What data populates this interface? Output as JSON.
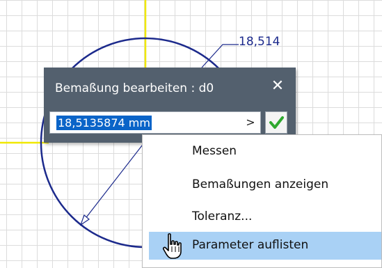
{
  "dimension": {
    "value_text": "18,514"
  },
  "dialog": {
    "title": "Bemaßung bearbeiten : d0",
    "close_icon": "close-icon",
    "input_value": "18,5135874 mm",
    "arrow_icon": "chevron-right-icon",
    "accept_icon": "checkmark-icon"
  },
  "context_menu": {
    "items": [
      {
        "label": "Messen",
        "highlighted": false
      },
      {
        "label": "Bemaßungen anzeigen",
        "highlighted": false
      },
      {
        "label": "Toleranz...",
        "highlighted": false
      },
      {
        "label": "Parameter auflisten",
        "highlighted": true
      }
    ]
  },
  "cursor": {
    "icon": "hand-pointer-icon"
  },
  "colors": {
    "dialog_bg": "#53606e",
    "sketch_line": "#1c2a8c",
    "axis": "#f0e800",
    "selection": "#0a64c8",
    "menu_highlight": "#a9d1f5",
    "check": "#2fa82f"
  }
}
